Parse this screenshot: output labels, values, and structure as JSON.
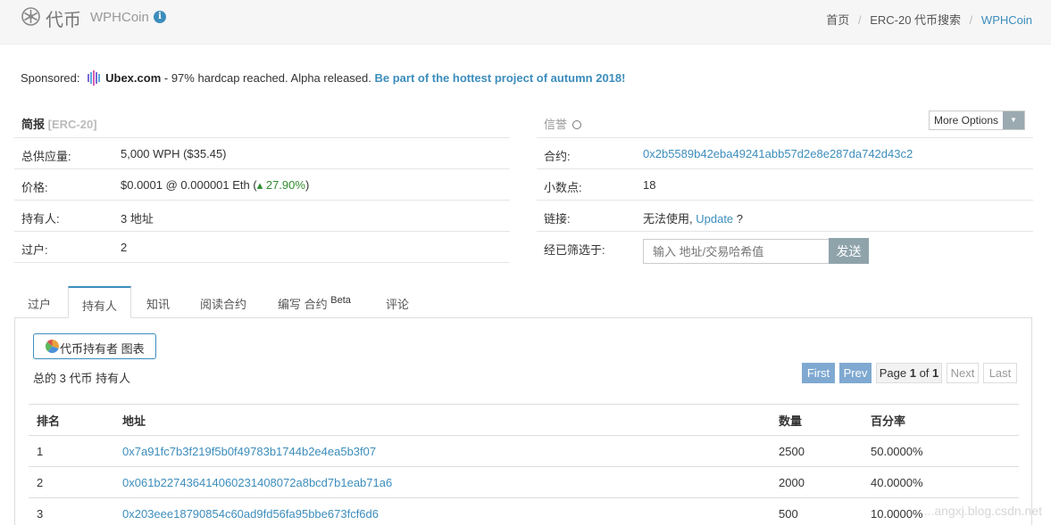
{
  "header": {
    "title": "代币",
    "subtitle": "WPHCoin",
    "breadcrumb": [
      "首页",
      "ERC-20 代币搜索",
      "WPHCoin"
    ]
  },
  "sponsored": {
    "label": "Sponsored:",
    "brand": "Ubex.com",
    "text": " - 97% hardcap reached. Alpha released. ",
    "cta": "Be part of the hottest project of autumn 2018!"
  },
  "overview": {
    "heading": "简报",
    "tag": "[ERC-20]",
    "rows": [
      {
        "label": "总供应量:",
        "value": "5,000 WPH ($35.45)"
      },
      {
        "label": "价格:",
        "value": "$0.0001 @ 0.000001 Eth (",
        "change": "27.90%",
        "suffix": ")"
      },
      {
        "label": "持有人:",
        "value": "3 地址"
      },
      {
        "label": "过户:",
        "value": "2"
      }
    ]
  },
  "profile": {
    "heading": "信誉",
    "more_options": "More Options",
    "contract_label": "合约:",
    "contract": "0x2b5589b42eba49241abb57d2e8e287da742d43c2",
    "decimals_label": "小数点:",
    "decimals": "18",
    "links_label": "链接:",
    "links_text": "无法使用, ",
    "links_update": "Update",
    "links_q": " ?",
    "filter_label": "经已筛选于:",
    "filter_placeholder": "输入 地址/交易哈希值",
    "filter_button": "发送"
  },
  "tabs": [
    {
      "label": "过户"
    },
    {
      "label": "持有人"
    },
    {
      "label": "知讯"
    },
    {
      "label": "阅读合约"
    },
    {
      "label": "编写 合约",
      "sup": "Beta"
    },
    {
      "label": "评论"
    }
  ],
  "holders": {
    "chart_button": "代币持有者 图表",
    "summary": "总的 3 代币 持有人",
    "pager": {
      "first": "First",
      "prev": "Prev",
      "page_prefix": "Page ",
      "page": "1",
      "of": " of ",
      "total": "1",
      "next": "Next",
      "last": "Last"
    },
    "columns": [
      "排名",
      "地址",
      "数量",
      "百分率"
    ],
    "rows": [
      {
        "rank": "1",
        "address": "0x7a91fc7b3f219f5b0f49783b1744b2e4ea5b3f07",
        "quantity": "2500",
        "percentage": "50.0000%"
      },
      {
        "rank": "2",
        "address": "0x061b227436414060231408072a8bcd7b1eab71a6",
        "quantity": "2000",
        "percentage": "40.0000%"
      },
      {
        "rank": "3",
        "address": "0x203eee18790854c60ad9fd56fa95bbe673fcf6d6",
        "quantity": "500",
        "percentage": "10.0000%"
      }
    ]
  },
  "watermark": "...angxj.blog.csdn.net"
}
